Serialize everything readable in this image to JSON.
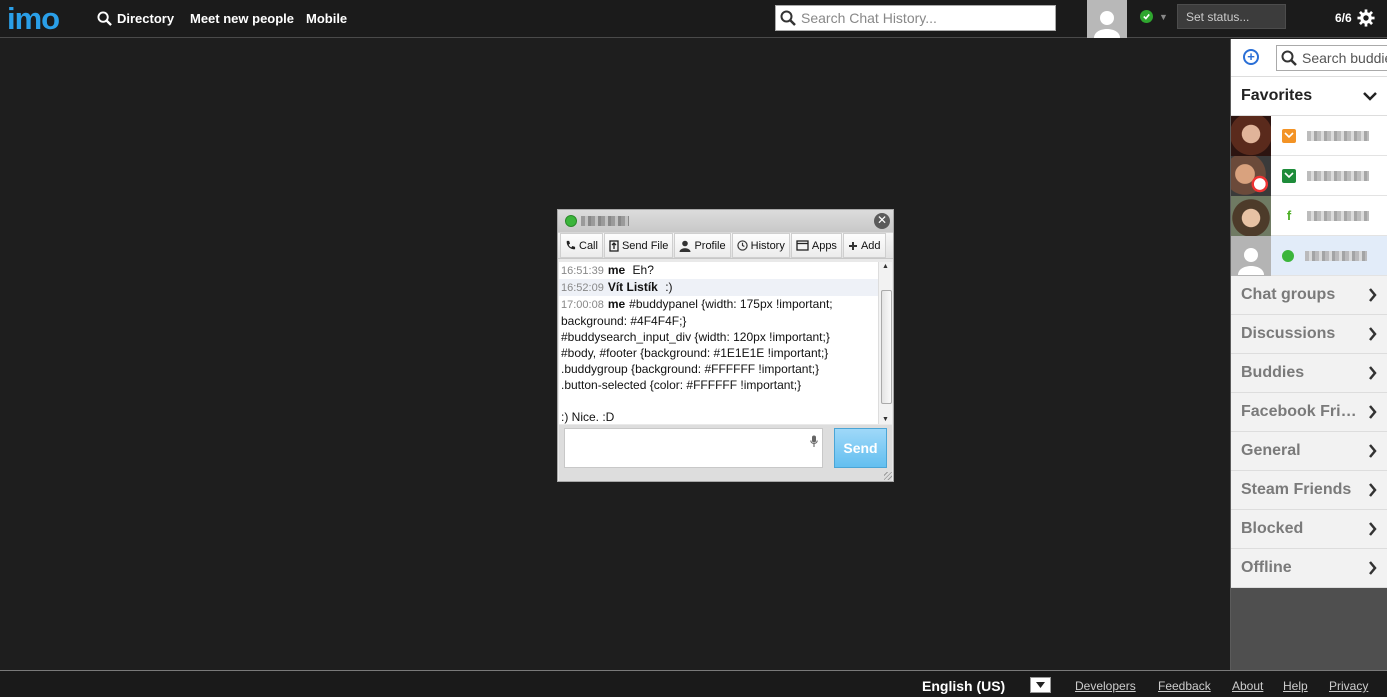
{
  "topbar": {
    "logo": "imo",
    "nav": [
      {
        "id": "directory",
        "label": "Directory"
      },
      {
        "id": "meet",
        "label": "Meet new people"
      },
      {
        "id": "mobile",
        "label": "Mobile"
      }
    ],
    "search_placeholder": "Search Chat History...",
    "set_status_placeholder": "Set status...",
    "count": "6/6"
  },
  "buddy_panel": {
    "search_placeholder": "Search buddies",
    "favorites_label": "Favorites",
    "groups": [
      "Chat groups",
      "Discussions",
      "Buddies",
      "Facebook Friends",
      "General",
      "Steam Friends",
      "Blocked",
      "Offline"
    ]
  },
  "chat": {
    "toolbar": {
      "call": "Call",
      "send_file": "Send File",
      "profile": "Profile",
      "history": "History",
      "apps": "Apps",
      "add": "Add"
    },
    "messages": [
      {
        "time": "16:51:39",
        "sender": "me",
        "text": "Eh?"
      },
      {
        "time": "16:52:09",
        "sender": "Vít Listík",
        "text": ":)"
      },
      {
        "time": "17:00:08",
        "sender": "me",
        "text": "#buddypanel {width: 175px !important; background: #4F4F4F;}\n#buddysearch_input_div {width: 120px !important;}\n#body, #footer {background: #1E1E1E !important;}\n.buddygroup {background: #FFFFFF !important;}\n.button-selected {color: #FFFFFF !important;}\n\n:) Nice. :D"
      }
    ],
    "send_label": "Send"
  },
  "footer": {
    "language": "English (US)",
    "links": [
      "Developers",
      "Feedback",
      "About",
      "Help",
      "Privacy"
    ]
  },
  "colors": {
    "brand": "#2a9fe8",
    "background": "#1e1e1e",
    "buddy_panel": "#4f4f4f",
    "send_button": "#63bff0",
    "online": "#3bb53b"
  }
}
